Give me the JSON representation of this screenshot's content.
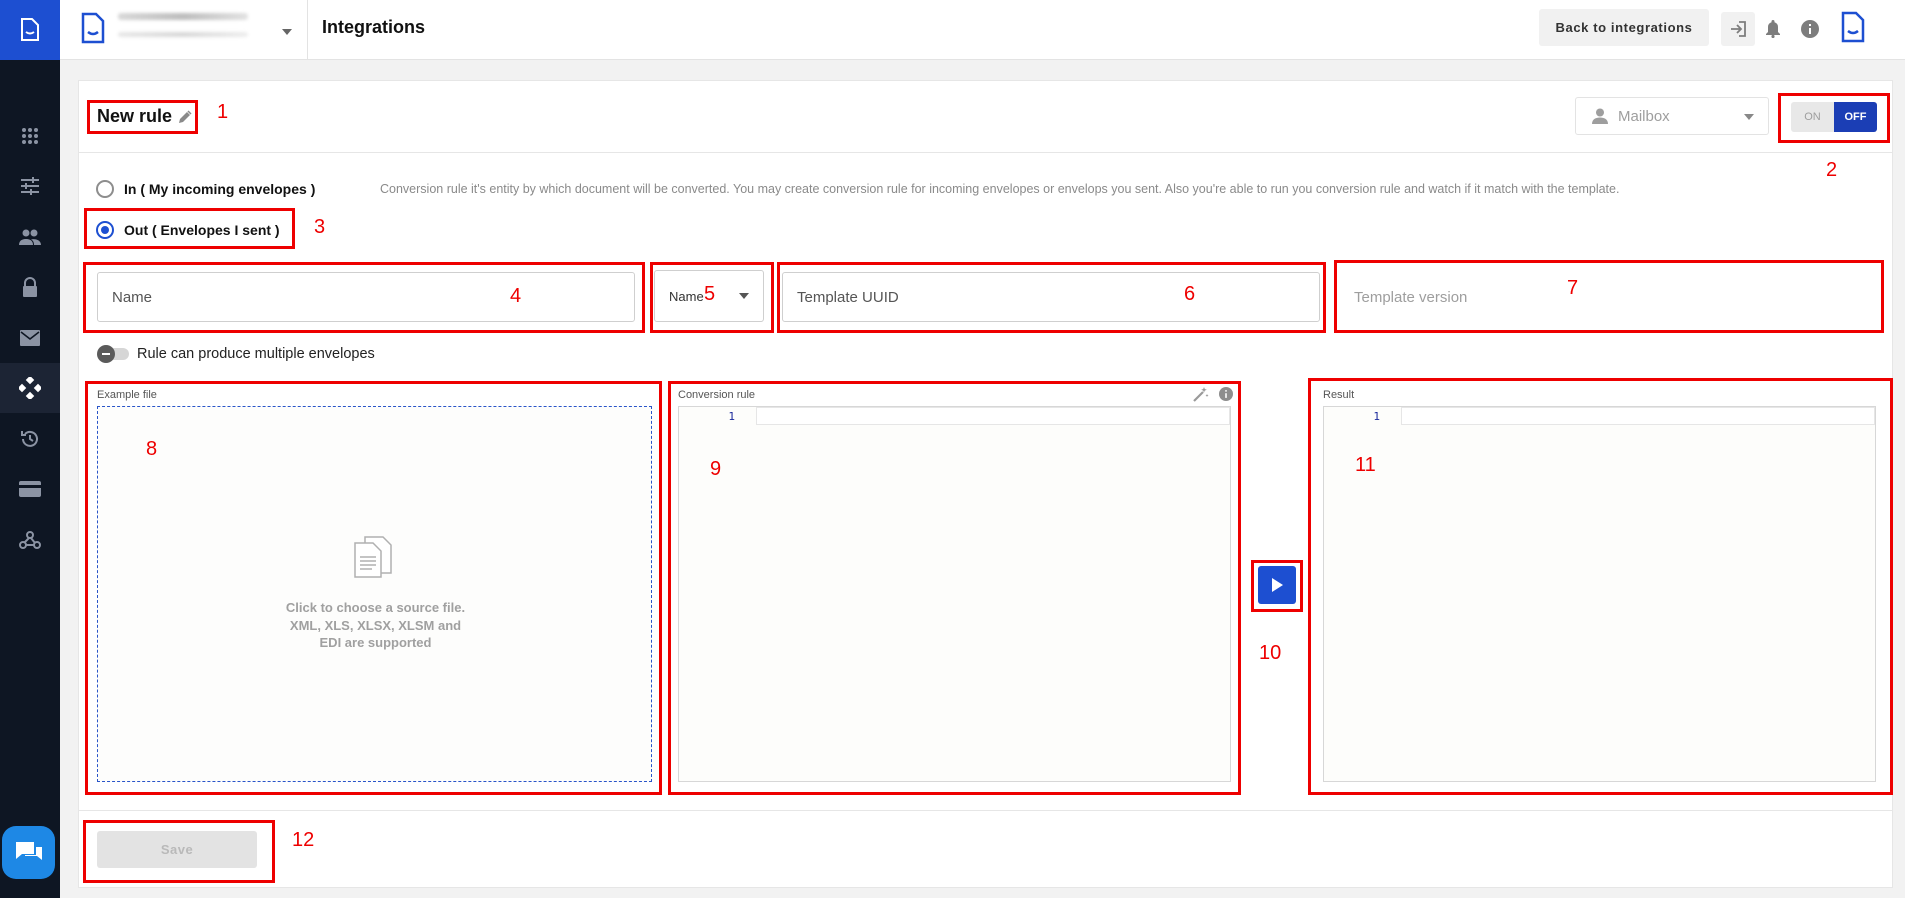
{
  "topbar": {
    "page_title": "Integrations",
    "back_label": "Back to integrations"
  },
  "rule": {
    "title": "New rule",
    "mailbox_placeholder": "Mailbox",
    "toggle_on": "ON",
    "toggle_off": "OFF",
    "toggle_state": "OFF"
  },
  "direction": {
    "in_label": "In ( My incoming envelopes )",
    "out_label": "Out ( Envelopes I sent )",
    "selected": "out",
    "hint": "Conversion rule it's entity by which document will be converted. You may create conversion rule for incoming envelopes or envelops you sent. Also you're able to run you conversion rule and watch if it match with the template."
  },
  "fields": {
    "name_placeholder": "Name",
    "name_select": "Name",
    "template_uuid_placeholder": "Template UUID",
    "template_version_placeholder": "Template version"
  },
  "multiple_envelopes_label": "Rule can produce multiple envelopes",
  "panels": {
    "example_file_label": "Example file",
    "dropzone_line1": "Click to choose a source file.",
    "dropzone_line2": "XML, XLS, XLSX, XLSM and",
    "dropzone_line3": "EDI are supported",
    "conversion_rule_label": "Conversion rule",
    "result_label": "Result",
    "line_number": "1"
  },
  "footer": {
    "save_label": "Save"
  },
  "annotations": [
    "1",
    "2",
    "3",
    "4",
    "5",
    "6",
    "7",
    "8",
    "9",
    "10",
    "11",
    "12"
  ],
  "colors": {
    "sidebar": "#0e1623",
    "brand": "#1d4fd1",
    "annotation": "#ee0000",
    "toggle_off": "#1b3eb5",
    "chat": "#1e88e5"
  },
  "icons": {
    "sidebar": [
      "apps-icon",
      "sliders-icon",
      "users-icon",
      "lock-icon",
      "mail-icon",
      "integrations-icon",
      "history-icon",
      "card-icon",
      "webhook-icon"
    ]
  }
}
